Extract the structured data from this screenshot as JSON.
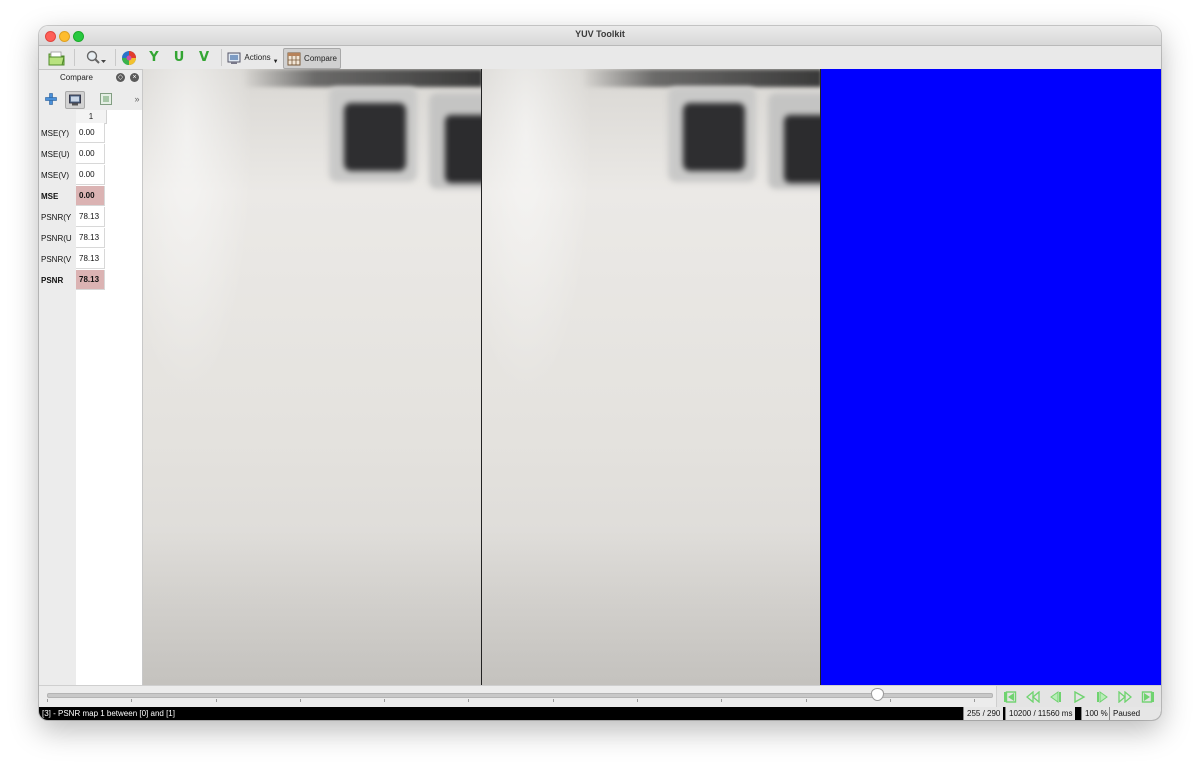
{
  "window": {
    "title": "YUV Toolkit"
  },
  "toolbar": {
    "channels": {
      "y": "Y",
      "u": "U",
      "v": "V"
    },
    "actions_label": "Actions",
    "compare_label": "Compare"
  },
  "compare_panel": {
    "title": "Compare",
    "column_header": "1",
    "rows": [
      {
        "label": "MSE(Y)",
        "value": "0.00",
        "highlight": false
      },
      {
        "label": "MSE(U)",
        "value": "0.00",
        "highlight": false
      },
      {
        "label": "MSE(V)",
        "value": "0.00",
        "highlight": false
      },
      {
        "label": "MSE",
        "value": "0.00",
        "highlight": true
      },
      {
        "label": "PSNR(Y",
        "value": "78.13",
        "highlight": false
      },
      {
        "label": "PSNR(U",
        "value": "78.13",
        "highlight": false
      },
      {
        "label": "PSNR(V",
        "value": "78.13",
        "highlight": false
      },
      {
        "label": "PSNR",
        "value": "78.13",
        "highlight": true
      }
    ]
  },
  "views": {
    "psnr_map_color": "#0000ff"
  },
  "playback": {
    "position_fraction": 0.879
  },
  "status": {
    "message": "[3] - PSNR map 1 between [0] and [1]",
    "frame": "255 / 290",
    "time": "10200 / 11560 ms",
    "zoom": "100 %",
    "state": "Paused"
  },
  "colors": {
    "highlight_cell": "#dbb3b3",
    "channel_green": "#33a533",
    "player_green": "#4cc24c"
  }
}
